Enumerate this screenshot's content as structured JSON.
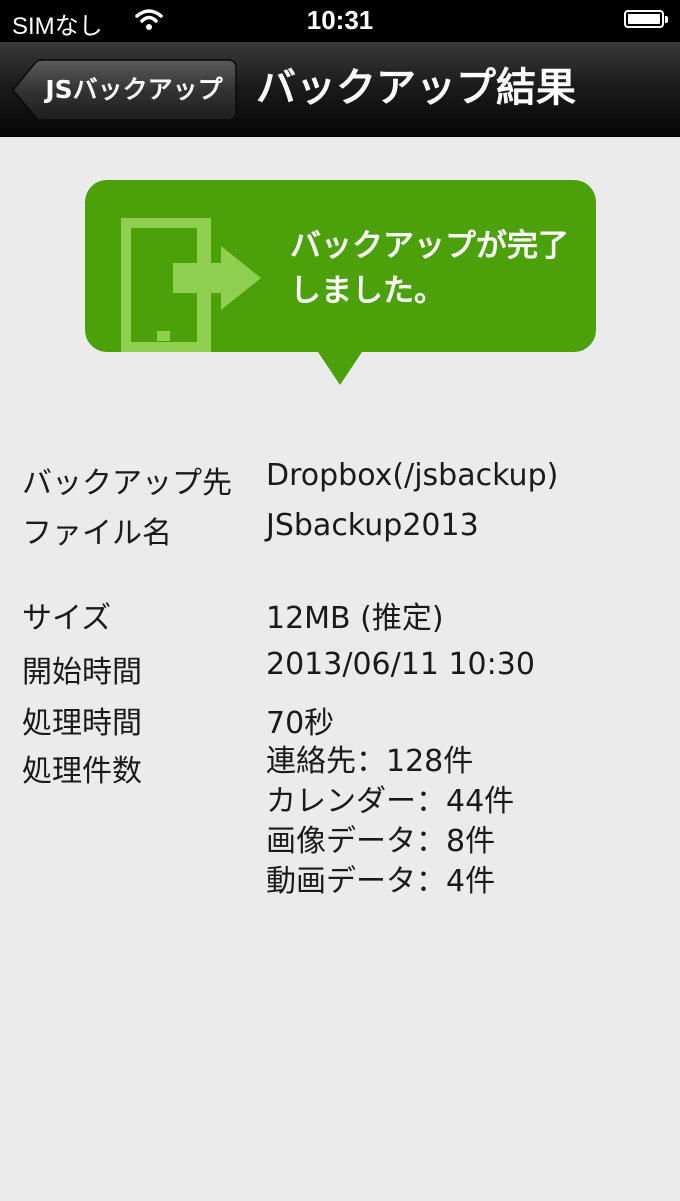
{
  "status_bar": {
    "carrier": "SIMなし",
    "time": "10:31"
  },
  "nav": {
    "back_label": "JSバックアップ",
    "title": "バックアップ結果"
  },
  "bubble": {
    "message": "バックアップが完了しました。"
  },
  "details": {
    "destination": {
      "label": "バックアップ先",
      "value": "Dropbox(/jsbackup)"
    },
    "filename": {
      "label": "ファイル名",
      "value": "JSbackup2013"
    },
    "size": {
      "label": "サイズ",
      "value": "12MB (推定)"
    },
    "start_time": {
      "label": "開始時間",
      "value": "2013/06/11 10:30"
    },
    "duration": {
      "label": "処理時間",
      "value": "70秒"
    },
    "counts": {
      "label": "処理件数",
      "items": [
        "連絡先：128件",
        "カレンダー：44件",
        "画像データ：8件",
        "動画データ：4件"
      ]
    }
  },
  "colors": {
    "accent_green": "#4ca10b",
    "background": "#ebebeb"
  }
}
